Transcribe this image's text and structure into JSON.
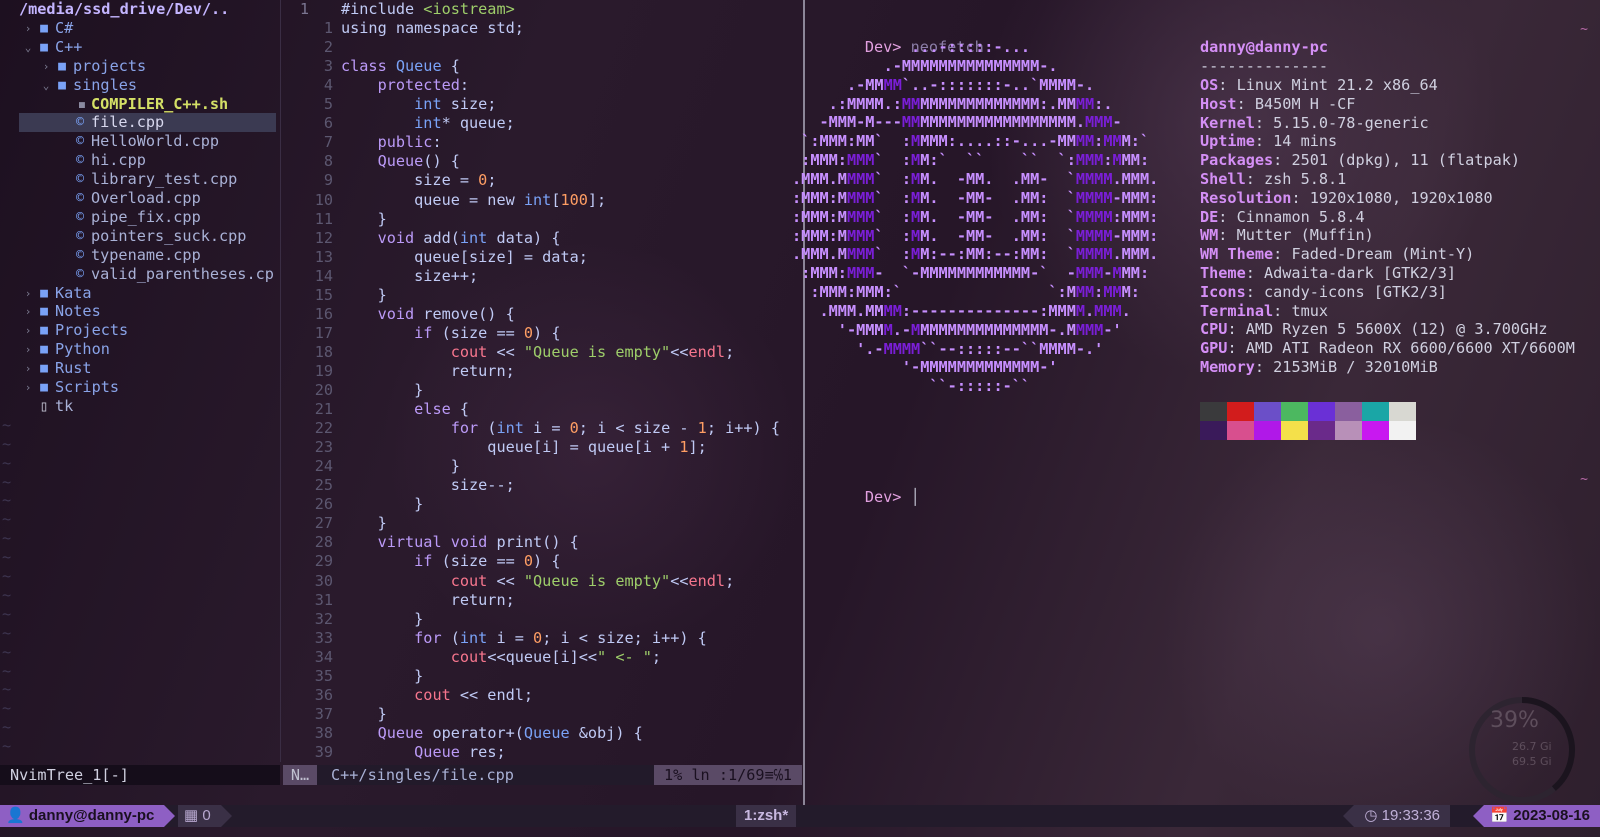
{
  "colors": {
    "purple_accent": "#8e5fc4",
    "keyword": "#bb9af7",
    "type": "#7aa2f7",
    "number": "#ff9e64",
    "string": "#9ece6a",
    "neofetch_key": "#d48ff5",
    "logo_light": "#c78fff",
    "logo_dark": "#7a1ed6"
  },
  "tree": {
    "root_path": "/media/ssd_drive/Dev/..",
    "items": [
      {
        "label": "C#",
        "kind": "folder",
        "depth": 0,
        "open": false,
        "icon": "folder-icon"
      },
      {
        "label": "C++",
        "kind": "folder",
        "depth": 0,
        "open": true,
        "icon": "folder-open-icon"
      },
      {
        "label": "projects",
        "kind": "folder",
        "depth": 1,
        "open": false,
        "icon": "folder-icon"
      },
      {
        "label": "singles",
        "kind": "folder",
        "depth": 1,
        "open": true,
        "icon": "folder-open-icon"
      },
      {
        "label": "COMPILER_C++.sh",
        "kind": "exec",
        "depth": 2,
        "icon": "terminal-icon"
      },
      {
        "label": "file.cpp",
        "kind": "file",
        "depth": 2,
        "icon": "cpp-icon",
        "selected": true
      },
      {
        "label": "HelloWorld.cpp",
        "kind": "file",
        "depth": 2,
        "icon": "cpp-icon"
      },
      {
        "label": "hi.cpp",
        "kind": "file",
        "depth": 2,
        "icon": "cpp-icon"
      },
      {
        "label": "library_test.cpp",
        "kind": "file",
        "depth": 2,
        "icon": "cpp-icon"
      },
      {
        "label": "Overload.cpp",
        "kind": "file",
        "depth": 2,
        "icon": "cpp-icon"
      },
      {
        "label": "pipe_fix.cpp",
        "kind": "file",
        "depth": 2,
        "icon": "cpp-icon"
      },
      {
        "label": "pointers_suck.cpp",
        "kind": "file",
        "depth": 2,
        "icon": "cpp-icon"
      },
      {
        "label": "typename.cpp",
        "kind": "file",
        "depth": 2,
        "icon": "cpp-icon"
      },
      {
        "label": "valid_parentheses.cp",
        "kind": "file",
        "depth": 2,
        "icon": "cpp-icon"
      },
      {
        "label": "Kata",
        "kind": "folder",
        "depth": 0,
        "open": false,
        "icon": "folder-icon"
      },
      {
        "label": "Notes",
        "kind": "folder",
        "depth": 0,
        "open": false,
        "icon": "folder-icon"
      },
      {
        "label": "Projects",
        "kind": "folder",
        "depth": 0,
        "open": false,
        "icon": "folder-icon"
      },
      {
        "label": "Python",
        "kind": "folder",
        "depth": 0,
        "open": false,
        "icon": "folder-icon"
      },
      {
        "label": "Rust",
        "kind": "folder",
        "depth": 0,
        "open": false,
        "icon": "folder-icon"
      },
      {
        "label": "Scripts",
        "kind": "folder",
        "depth": 0,
        "open": false,
        "icon": "folder-icon"
      },
      {
        "label": "tk",
        "kind": "plain",
        "depth": 0,
        "icon": "file-icon"
      }
    ],
    "status": "NvimTree_1[-]"
  },
  "editor": {
    "lines": [
      [
        [
          "p",
          "#include "
        ],
        [
          "s",
          "<iostream>"
        ]
      ],
      [
        [
          "p",
          "using namespace std;"
        ]
      ],
      [
        [
          "p",
          ""
        ]
      ],
      [
        [
          "k",
          "class "
        ],
        [
          "t",
          "Queue"
        ],
        [
          "p",
          " {"
        ]
      ],
      [
        [
          "p",
          "    "
        ],
        [
          "k",
          "protected"
        ],
        [
          "p",
          ":"
        ]
      ],
      [
        [
          "p",
          "        "
        ],
        [
          "t",
          "int"
        ],
        [
          "p",
          " size;"
        ]
      ],
      [
        [
          "p",
          "        "
        ],
        [
          "t",
          "int"
        ],
        [
          "p",
          "* queue;"
        ]
      ],
      [
        [
          "p",
          "    "
        ],
        [
          "k",
          "public"
        ],
        [
          "p",
          ":"
        ]
      ],
      [
        [
          "p",
          "    "
        ],
        [
          "k",
          "Queue"
        ],
        [
          "p",
          "() {"
        ]
      ],
      [
        [
          "p",
          "        size = "
        ],
        [
          "n",
          "0"
        ],
        [
          "p",
          ";"
        ]
      ],
      [
        [
          "p",
          "        queue = new "
        ],
        [
          "t",
          "int"
        ],
        [
          "p",
          "["
        ],
        [
          "n",
          "100"
        ],
        [
          "p",
          "];"
        ]
      ],
      [
        [
          "p",
          "    }"
        ]
      ],
      [
        [
          "p",
          "    "
        ],
        [
          "k",
          "void "
        ],
        [
          "p",
          "add("
        ],
        [
          "t",
          "int"
        ],
        [
          "p",
          " data) {"
        ]
      ],
      [
        [
          "p",
          "        queue[size] = data;"
        ]
      ],
      [
        [
          "p",
          "        size++;"
        ]
      ],
      [
        [
          "p",
          "    }"
        ]
      ],
      [
        [
          "p",
          "    "
        ],
        [
          "k",
          "void "
        ],
        [
          "p",
          "remove() {"
        ]
      ],
      [
        [
          "p",
          "        "
        ],
        [
          "k",
          "if"
        ],
        [
          "p",
          " (size == "
        ],
        [
          "n",
          "0"
        ],
        [
          "p",
          ") {"
        ]
      ],
      [
        [
          "p",
          "            "
        ],
        [
          "r",
          "cout"
        ],
        [
          "p",
          " << "
        ],
        [
          "s",
          "\"Queue is empty\""
        ],
        [
          "p",
          "<<"
        ],
        [
          "r",
          "endl"
        ],
        [
          "p",
          ";"
        ]
      ],
      [
        [
          "p",
          "            return;"
        ]
      ],
      [
        [
          "p",
          "        }"
        ]
      ],
      [
        [
          "p",
          "        "
        ],
        [
          "k",
          "else"
        ],
        [
          "p",
          " {"
        ]
      ],
      [
        [
          "p",
          "            "
        ],
        [
          "k",
          "for"
        ],
        [
          "p",
          " ("
        ],
        [
          "t",
          "int"
        ],
        [
          "p",
          " i = "
        ],
        [
          "n",
          "0"
        ],
        [
          "p",
          "; i < size - "
        ],
        [
          "n",
          "1"
        ],
        [
          "p",
          "; i++) {"
        ]
      ],
      [
        [
          "p",
          "                queue[i] = queue[i + "
        ],
        [
          "n",
          "1"
        ],
        [
          "p",
          "];"
        ]
      ],
      [
        [
          "p",
          "            }"
        ]
      ],
      [
        [
          "p",
          "            size--;"
        ]
      ],
      [
        [
          "p",
          "        }"
        ]
      ],
      [
        [
          "p",
          "    }"
        ]
      ],
      [
        [
          "p",
          "    "
        ],
        [
          "k",
          "virtual void "
        ],
        [
          "p",
          "print() {"
        ]
      ],
      [
        [
          "p",
          "        "
        ],
        [
          "k",
          "if"
        ],
        [
          "p",
          " (size == "
        ],
        [
          "n",
          "0"
        ],
        [
          "p",
          ") {"
        ]
      ],
      [
        [
          "p",
          "            "
        ],
        [
          "r",
          "cout"
        ],
        [
          "p",
          " << "
        ],
        [
          "s",
          "\"Queue is empty\""
        ],
        [
          "p",
          "<<"
        ],
        [
          "r",
          "endl"
        ],
        [
          "p",
          ";"
        ]
      ],
      [
        [
          "p",
          "            return;"
        ]
      ],
      [
        [
          "p",
          "        }"
        ]
      ],
      [
        [
          "p",
          "        "
        ],
        [
          "k",
          "for"
        ],
        [
          "p",
          " ("
        ],
        [
          "t",
          "int"
        ],
        [
          "p",
          " i = "
        ],
        [
          "n",
          "0"
        ],
        [
          "p",
          "; i < size; i++) {"
        ]
      ],
      [
        [
          "p",
          "            "
        ],
        [
          "r",
          "cout"
        ],
        [
          "p",
          "<<queue[i]<<"
        ],
        [
          "s",
          "\" <- \""
        ],
        [
          "p",
          ";"
        ]
      ],
      [
        [
          "p",
          "        }"
        ]
      ],
      [
        [
          "p",
          "        "
        ],
        [
          "r",
          "cout"
        ],
        [
          "p",
          " << endl;"
        ]
      ],
      [
        [
          "p",
          "    }"
        ]
      ],
      [
        [
          "p",
          "    "
        ],
        [
          "k",
          "Queue "
        ],
        [
          "p",
          "operator+("
        ],
        [
          "t",
          "Queue"
        ],
        [
          "p",
          " &obj) {"
        ]
      ],
      [
        [
          "p",
          "        "
        ],
        [
          "k",
          "Queue "
        ],
        [
          "p",
          "res;"
        ]
      ]
    ],
    "line_numbers": [
      "1",
      "1",
      "2",
      "3",
      "4",
      "5",
      "6",
      "7",
      "8",
      "9",
      "10",
      "11",
      "12",
      "13",
      "14",
      "15",
      "16",
      "17",
      "18",
      "19",
      "20",
      "21",
      "22",
      "23",
      "24",
      "25",
      "26",
      "27",
      "28",
      "29",
      "30",
      "31",
      "32",
      "33",
      "34",
      "35",
      "36",
      "37",
      "38",
      "39"
    ],
    "status": {
      "mode": "N…",
      "file": "C++/singles/file.cpp",
      "position": "1%  ln :1/69≡℅1"
    }
  },
  "terminal": {
    "prompt": "Dev>",
    "command": "neofetch",
    "user_host": "danny@danny-pc",
    "separator": "--------------",
    "info": [
      {
        "key": "OS",
        "value": "Linux Mint 21.2 x86_64"
      },
      {
        "key": "Host",
        "value": "B450M H -CF"
      },
      {
        "key": "Kernel",
        "value": "5.15.0-78-generic"
      },
      {
        "key": "Uptime",
        "value": "14 mins"
      },
      {
        "key": "Packages",
        "value": "2501 (dpkg), 11 (flatpak)"
      },
      {
        "key": "Shell",
        "value": "zsh 5.8.1"
      },
      {
        "key": "Resolution",
        "value": "1920x1080, 1920x1080"
      },
      {
        "key": "DE",
        "value": "Cinnamon 5.8.4"
      },
      {
        "key": "WM",
        "value": "Mutter (Muffin)"
      },
      {
        "key": "WM Theme",
        "value": "Faded-Dream (Mint-Y)"
      },
      {
        "key": "Theme",
        "value": "Adwaita-dark [GTK2/3]"
      },
      {
        "key": "Icons",
        "value": "candy-icons [GTK2/3]"
      },
      {
        "key": "Terminal",
        "value": "tmux"
      },
      {
        "key": "CPU",
        "value": "AMD Ryzen 5 5600X (12) @ 3.700GHz"
      },
      {
        "key": "GPU",
        "value": "AMD ATI Radeon RX 6600/6600 XT/6600M"
      },
      {
        "key": "Memory",
        "value": "2153MiB / 32010MiB"
      }
    ],
    "logo": [
      "             ...-:::::-...",
      "          .-MMMMMMMMMMMMMMM-.",
      "      .-MMMM`..-:::::::-..`MMMM-.",
      "    .:MMMM.:MMMMMMMMMMMMMMM:.MMMM:.",
      "   -MMM-M---MMMMMMMMMMMMMMMMMMM.MMM-",
      " `:MMM:MM`  :MMMM:....::-...-MMMM:MMM:`",
      " :MMM:MMM`  :MM:`  ``    ``  `:MMM:MMM:",
      ".MMM.MMMM`  :MM.  -MM.  .MM-  `MMMM.MMM.",
      ":MMM:MMMM`  :MM.  -MM-  .MM:  `MMMM-MMM:",
      ":MMM:MMMM`  :MM.  -MM-  .MM:  `MMMM:MMM:",
      ":MMM:MMMM`  :MM.  -MM-  .MM:  `MMMM-MMM:",
      ".MMM.MMMM`  :MM:--:MM:--:MM:  `MMMM.MMM.",
      " :MMM:MMM-  `-MMMMMMMMMMMM-`  -MMM-MMM:",
      "  :MMM:MMM:`                `:MMM:MMM:",
      "   .MMM.MMMM:--------------:MMMM.MMM.",
      "     '-MMMM.-MMMMMMMMMMMMMMM-.MMMM-'",
      "       '.-MMMM``--:::::--``MMMM-.'",
      "            '-MMMMMMMMMMMMM-'",
      "               ``-:::::-``"
    ],
    "palette_top": [
      "#3a3a3c",
      "#d21c1c",
      "#6b4fc8",
      "#4cb860",
      "#6a30d6",
      "#8a5f9e",
      "#1aa6a6",
      "#d8d8d2"
    ],
    "palette_bottom": [
      "#3a1a5a",
      "#d84f8e",
      "#b018e8",
      "#f4e04a",
      "#6a2a8a",
      "#b890b8",
      "#c818f0",
      "#f2f2f2"
    ],
    "tilde": "~"
  },
  "tmux": {
    "user": "danny@danny-pc",
    "windows": "0",
    "current_window": "1:zsh*",
    "time": "19:33:36",
    "date": "2023-08-16"
  },
  "desktop_widget": {
    "percent": "39%",
    "used": "26.7 Gi",
    "total": "69.5 Gi"
  }
}
